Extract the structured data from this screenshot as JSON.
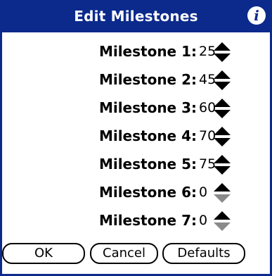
{
  "dialog": {
    "title": "Edit Milestones",
    "info_icon": "info-icon"
  },
  "milestones": [
    {
      "label": "Milestone 1:",
      "value": "25",
      "down_enabled": true
    },
    {
      "label": "Milestone 2:",
      "value": "45",
      "down_enabled": true
    },
    {
      "label": "Milestone 3:",
      "value": "60",
      "down_enabled": true
    },
    {
      "label": "Milestone 4:",
      "value": "70",
      "down_enabled": true
    },
    {
      "label": "Milestone 5:",
      "value": "75",
      "down_enabled": true
    },
    {
      "label": "Milestone 6:",
      "value": "0",
      "down_enabled": false
    },
    {
      "label": "Milestone 7:",
      "value": "0",
      "down_enabled": false
    }
  ],
  "buttons": {
    "ok": "OK",
    "cancel": "Cancel",
    "defaults": "Defaults"
  },
  "colors": {
    "title_bar": "#0b2a8c",
    "arrow_enabled": "#000000",
    "arrow_disabled": "#8a8a8a"
  }
}
